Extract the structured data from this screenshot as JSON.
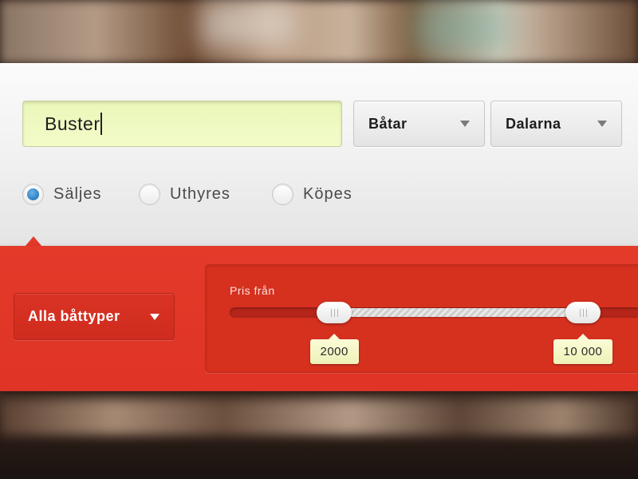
{
  "search": {
    "query": "Buster"
  },
  "filters": {
    "category": {
      "selected": "Båtar"
    },
    "region": {
      "selected": "Dalarna"
    }
  },
  "listing_type": {
    "options": [
      {
        "label": "Säljes",
        "checked": true
      },
      {
        "label": "Uthyres",
        "checked": false
      },
      {
        "label": "Köpes",
        "checked": false
      }
    ]
  },
  "boat_type": {
    "label": "Alla båttyper"
  },
  "price": {
    "label": "Pris från",
    "min_label": "2000",
    "max_label": "10 000",
    "min_value": 2000,
    "max_value": 10000
  },
  "colors": {
    "accent_red": "#e33a2a",
    "radio_selected": "#2b7fc4",
    "search_field": "#f3fbc9",
    "value_tag": "#fbfcd6"
  },
  "icons": {
    "dropdown": "chevron-down-icon",
    "slider_grip": "grip-lines-icon"
  }
}
